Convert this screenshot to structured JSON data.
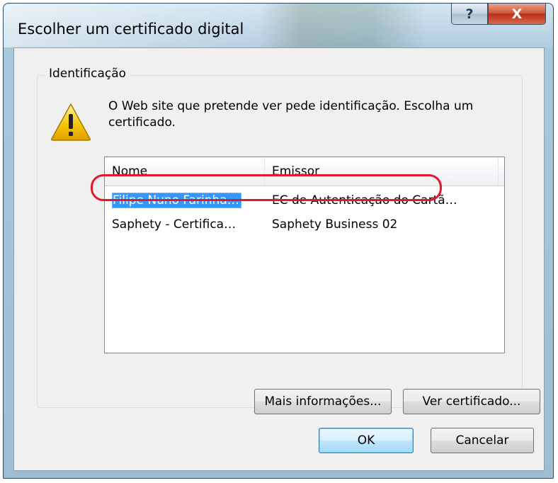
{
  "window": {
    "title": "Escolher um certificado digital",
    "help_glyph": "?",
    "close_glyph": "X"
  },
  "group": {
    "label": "Identificação",
    "message": "O Web site que pretende ver pede identificação. Escolha um certificado."
  },
  "list": {
    "columns": [
      "Nome",
      "Emissor"
    ],
    "rows": [
      {
        "nome": "Filipe Nuno Farinha…",
        "emissor": "EC de Autenticação do Cartã…",
        "selected": true
      },
      {
        "nome": "Saphety - Certifica…",
        "emissor": "Saphety Business 02",
        "selected": false
      }
    ]
  },
  "buttons": {
    "more_info": "Mais informações...",
    "view_cert": "Ver certificado...",
    "ok": "OK",
    "cancel": "Cancelar"
  },
  "colors": {
    "selection": "#3399ff",
    "highlight_ring": "#e2192a",
    "warning_fill": "#f5c400"
  },
  "icons": {
    "warning": "warning-icon",
    "help": "help-icon",
    "close": "close-icon"
  }
}
